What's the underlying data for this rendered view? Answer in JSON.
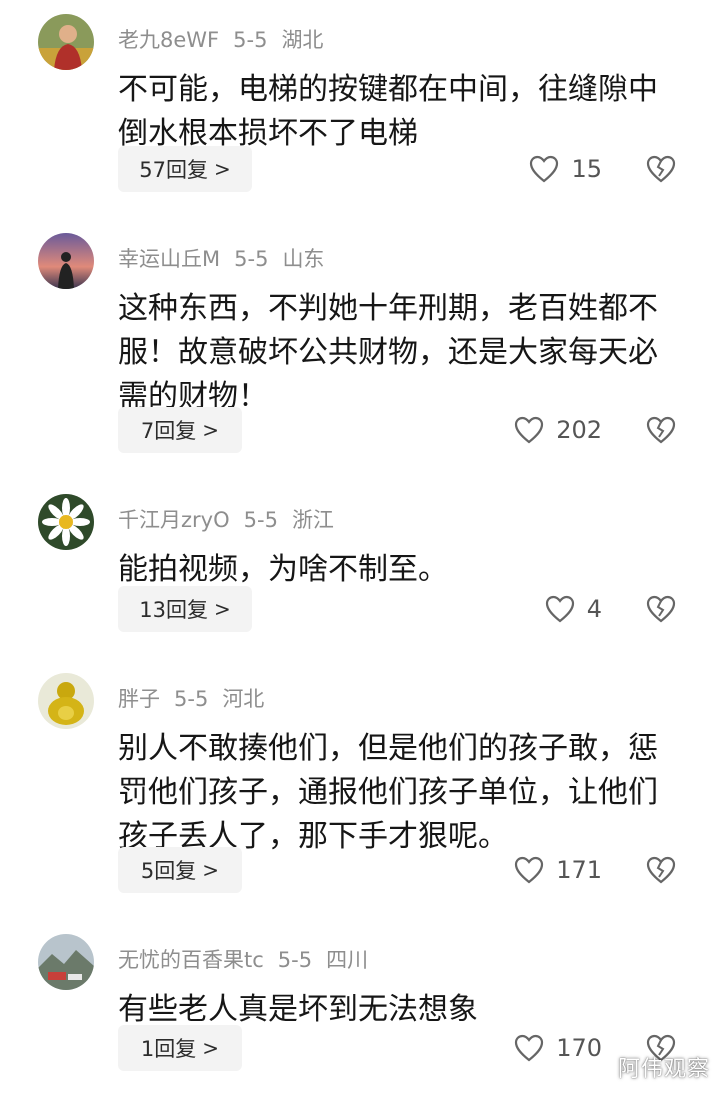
{
  "comments": [
    {
      "username": "老九8eWF",
      "date": "5-5",
      "location": "湖北",
      "text": "不可能，电梯的按键都在中间，往缝隙中倒水根本损坏不了电梯",
      "reply_label": "57回复",
      "likes": "15",
      "avatar": "person-field-avatar"
    },
    {
      "username": "幸运山丘M",
      "date": "5-5",
      "location": "山东",
      "text": "这种东西，不判她十年刑期，老百姓都不服！故意破坏公共财物，还是大家每天必需的财物！",
      "reply_label": "7回复",
      "likes": "202",
      "avatar": "sunset-silhouette-avatar"
    },
    {
      "username": "千江月zryO",
      "date": "5-5",
      "location": "浙江",
      "text": "能拍视频，为啥不制至。",
      "reply_label": "13回复",
      "likes": "4",
      "avatar": "daisy-flower-avatar"
    },
    {
      "username": "胖子",
      "date": "5-5",
      "location": "河北",
      "text": "别人不敢揍他们，但是他们的孩子敢，惩罚他们孩子，通报他们孩子单位，让他们孩子丢人了，那下手才狠呢。",
      "reply_label": "5回复",
      "likes": "171",
      "avatar": "golden-buddha-avatar"
    },
    {
      "username": "无忧的百香果tc",
      "date": "5-5",
      "location": "四川",
      "text": "有些老人真是坏到无法想象",
      "reply_label": "1回复",
      "likes": "170",
      "avatar": "landscape-photo-avatar"
    }
  ],
  "icons": {
    "reply_chevron": "chevron-right-icon",
    "like": "heart-outline-icon",
    "dislike": "broken-heart-icon"
  },
  "watermark": "阿伟观察",
  "colors": {
    "meta": "#8e8e8e",
    "text": "#161616",
    "reply_bg": "#f3f3f3"
  }
}
